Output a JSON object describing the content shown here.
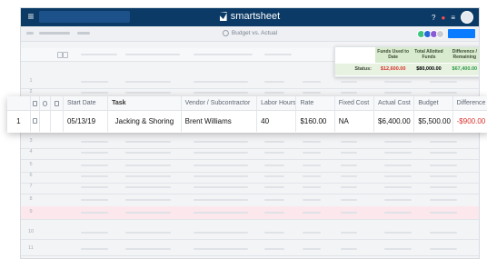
{
  "app": {
    "brand": "smartsheet",
    "sheet_name": "Budget vs. Actual"
  },
  "icons": {
    "menu": "menu-icon",
    "brand": "smartsheet-logo-icon",
    "help": "help-icon",
    "notifications": "bell-icon",
    "apps": "grid-icon",
    "avatar": "avatar-icon"
  },
  "summary": {
    "headers": [
      "Funds Used to Date",
      "Total Allotted Funds",
      "Difference / Remaining"
    ],
    "status_label": "Status:",
    "values": [
      "$12,600.00",
      "$80,000.00",
      "$67,400.00"
    ]
  },
  "table": {
    "columns": [
      "Start Date",
      "Task",
      "Vendor / Subcontractor",
      "Labor Hours",
      "Rate",
      "Fixed Cost",
      "Actual Cost",
      "Budget",
      "Difference"
    ],
    "row": {
      "num": "1",
      "start_date": "05/13/19",
      "task": "Jacking & Shoring",
      "vendor": "Brent Williams",
      "labor_hours": "40",
      "rate": "$160.00",
      "fixed_cost": "NA",
      "actual_cost": "$6,400.00",
      "budget": "$5,500.00",
      "difference": "-$900.00"
    }
  },
  "background_rows": [
    "1",
    "2",
    "3",
    "4",
    "5",
    "6",
    "7",
    "8",
    "9",
    "10",
    "11"
  ],
  "colors": {
    "topbar": "#0b3a66",
    "summary_green": "#d9ebcf",
    "negative": "#d9302a",
    "positive": "#2f9b49",
    "share": "#0a7cff"
  }
}
